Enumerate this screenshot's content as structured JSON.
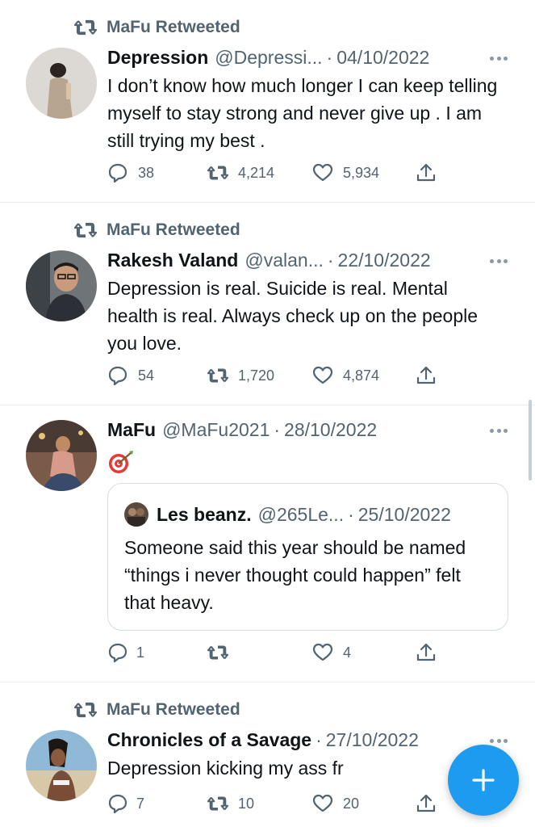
{
  "colors": {
    "accent": "#1d9bf0",
    "secondary_text": "#536471",
    "primary_text": "#0f1419",
    "divider": "#e6ecf0"
  },
  "tweets": [
    {
      "retweeted_by": "MaFu Retweeted",
      "name": "Depression",
      "handle": "@Depressi...",
      "date": "04/10/2022",
      "text": "I don’t know how much longer I can keep telling myself to stay strong and never give up . I am still trying my best .",
      "replies": "38",
      "retweets": "4,214",
      "likes": "5,934"
    },
    {
      "retweeted_by": "MaFu Retweeted",
      "name": "Rakesh Valand",
      "handle": "@valan...",
      "date": "22/10/2022",
      "text": "Depression is real. Suicide is real. Mental health is real. Always check up on the people you love.",
      "replies": "54",
      "retweets": "1,720",
      "likes": "4,874"
    },
    {
      "name": "MaFu",
      "handle": "@MaFu2021",
      "date": "28/10/2022",
      "emoji": "🎯",
      "quote": {
        "name": "Les beanz.",
        "handle": "@265Le...",
        "date": "25/10/2022",
        "text": "Someone said this year should be named “things i never thought could happen” felt that heavy."
      },
      "replies": "1",
      "retweets": "",
      "likes": "4"
    },
    {
      "retweeted_by": "MaFu Retweeted",
      "name": "Chronicles of a Savage",
      "date": "27/10/2022",
      "text": "Depression kicking my ass fr",
      "replies": "7",
      "retweets": "10",
      "likes": "20"
    }
  ],
  "compose_button": {
    "icon": "plus-icon"
  },
  "icons": {
    "reply": "reply-icon",
    "retweet": "retweet-icon",
    "like": "heart-icon",
    "share": "share-icon",
    "more": "more-icon"
  }
}
